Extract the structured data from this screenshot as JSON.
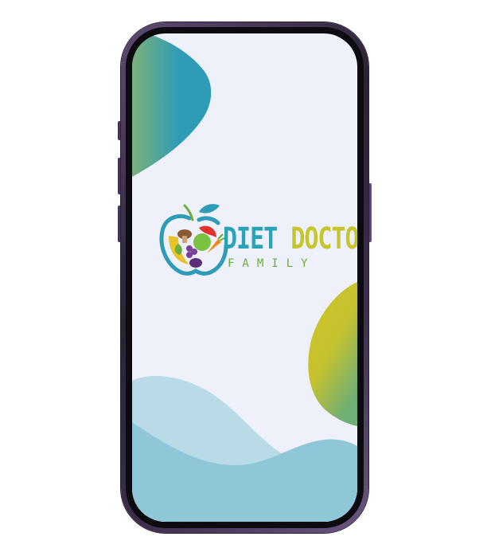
{
  "device": {
    "model": "phone-mockup",
    "frame_color": "#3d2f4c"
  },
  "splash": {
    "background_color": "#eef1fa",
    "brand": {
      "word1": "DIET",
      "word2": "DOCTOR",
      "subtitle": "FAMILY",
      "icon": "apple-fruits-vegetables-icon",
      "colors": {
        "word1": "#2aa3b6",
        "word2": "#c5c62c",
        "subtitle": "#6bae3a"
      }
    },
    "decorations": {
      "top_left_blob": [
        "#7bb07a",
        "#2e9cb6"
      ],
      "right_blob": [
        "#d2c62a",
        "#7ab06c"
      ],
      "bottom_waves": [
        "#b9dbe8",
        "#8fc7d9"
      ]
    }
  }
}
